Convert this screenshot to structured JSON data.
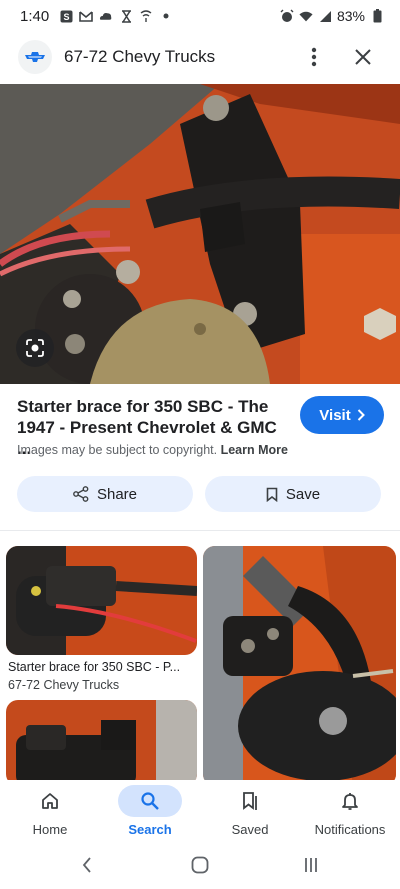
{
  "status_bar": {
    "time": "1:40",
    "battery": "83%"
  },
  "header": {
    "site_title": "67-72 Chevy Trucks"
  },
  "result": {
    "title": "Starter brace for 350 SBC - The 1947 - Present Chevrolet & GMC ...",
    "visit_label": "Visit",
    "copyright_text": "Images may be subject to copyright.",
    "learn_more": "Learn More",
    "share_label": "Share",
    "save_label": "Save"
  },
  "related": [
    {
      "caption": "Starter brace for 350 SBC - P...",
      "source": "67-72 Chevy Trucks"
    }
  ],
  "bottom_nav": [
    {
      "label": "Home",
      "icon": "home-icon",
      "active": false
    },
    {
      "label": "Search",
      "icon": "search-icon",
      "active": true
    },
    {
      "label": "Saved",
      "icon": "bookmarks-icon",
      "active": false
    },
    {
      "label": "Notifications",
      "icon": "bell-icon",
      "active": false
    }
  ],
  "colors": {
    "accent": "#1a73e8",
    "pill_bg": "#e8f0fe",
    "active_nav_bg": "#d3e3fd"
  }
}
